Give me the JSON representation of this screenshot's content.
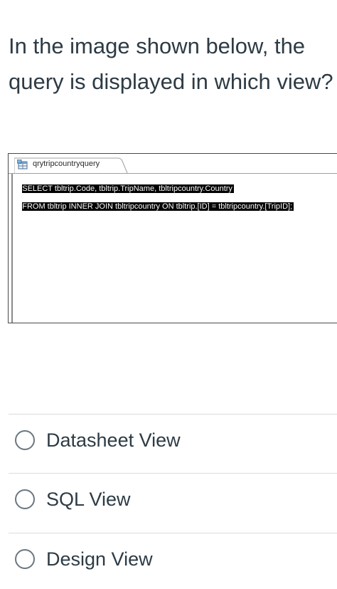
{
  "question": {
    "text": "In the image shown below, the query is displayed in which view?"
  },
  "screenshot": {
    "tab_label": "qrytripcountryquery",
    "tab_icon": "query-icon",
    "sql_lines": [
      "SELECT tbltrip.Code, tbltrip.TripName, tbltripcountry.Country",
      "FROM tbltrip INNER JOIN tbltripcountry ON tbltrip.[ID] = tbltripcountry.[TripID];"
    ]
  },
  "options": [
    {
      "label": "Datasheet View"
    },
    {
      "label": "SQL View"
    },
    {
      "label": "Design View"
    }
  ],
  "colors": {
    "text": "#2d3b45",
    "divider": "#d9dcde",
    "radio_border": "#6b7780",
    "sql_highlight_bg": "#000000",
    "sql_highlight_fg": "#ffffff"
  }
}
